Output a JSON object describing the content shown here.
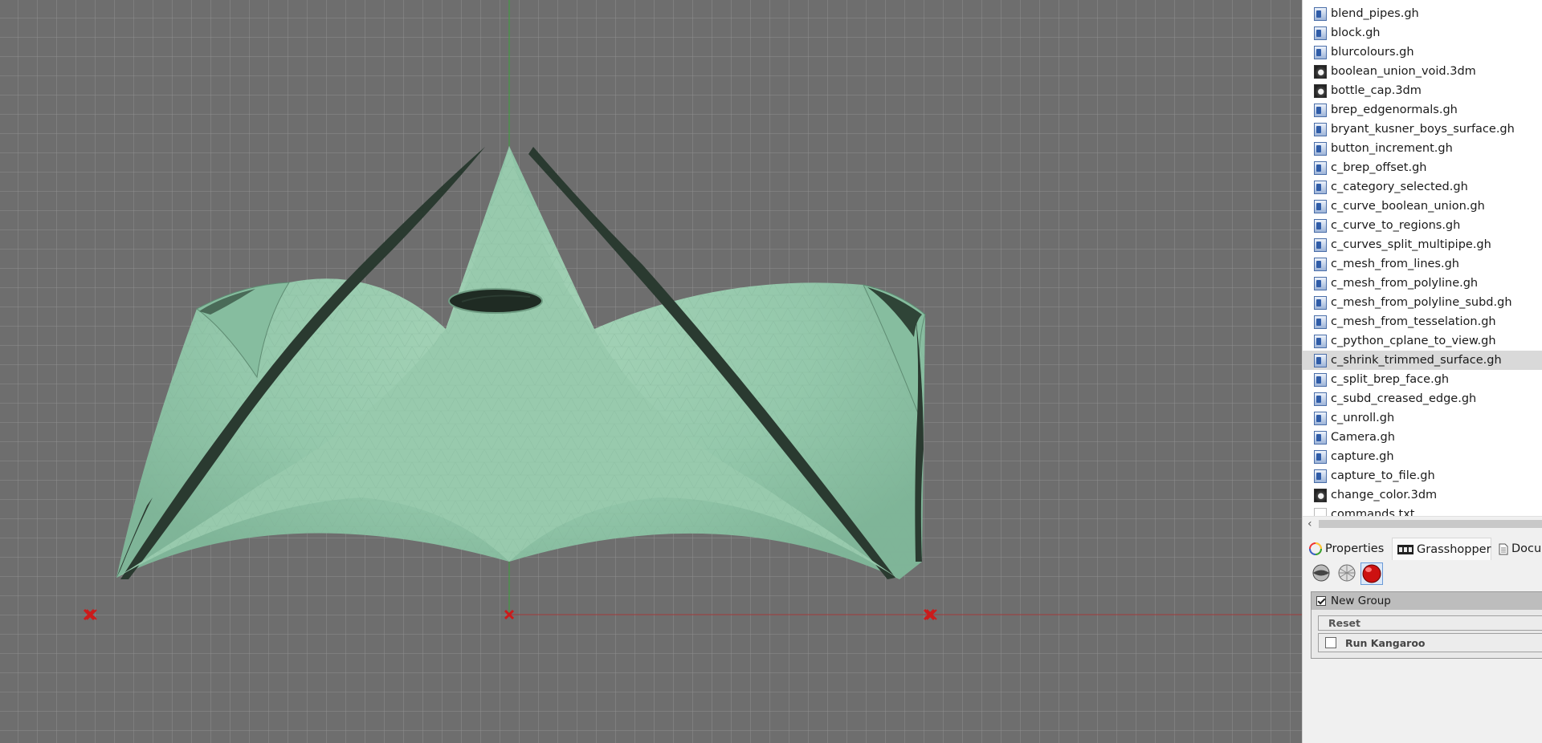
{
  "viewport": {
    "background": "#6e6e6e",
    "grid_color": "#8f8f8f",
    "surface_color": "#8fc3a5",
    "surface_dark": "#2a3a30",
    "x_axis_color": "#a23a3a",
    "y_axis_color": "#3aa23a",
    "anchor_color": "#cc1b1b"
  },
  "file_browser": {
    "files": [
      {
        "name": "blend_pipes.gh",
        "type": "gh"
      },
      {
        "name": "block.gh",
        "type": "gh"
      },
      {
        "name": "blurcolours.gh",
        "type": "gh"
      },
      {
        "name": "boolean_union_void.3dm",
        "type": "3dm"
      },
      {
        "name": "bottle_cap.3dm",
        "type": "3dm"
      },
      {
        "name": "brep_edgenormals.gh",
        "type": "gh"
      },
      {
        "name": "bryant_kusner_boys_surface.gh",
        "type": "gh"
      },
      {
        "name": "button_increment.gh",
        "type": "gh"
      },
      {
        "name": "c_brep_offset.gh",
        "type": "gh"
      },
      {
        "name": "c_category_selected.gh",
        "type": "gh"
      },
      {
        "name": "c_curve_boolean_union.gh",
        "type": "gh"
      },
      {
        "name": "c_curve_to_regions.gh",
        "type": "gh"
      },
      {
        "name": "c_curves_split_multipipe.gh",
        "type": "gh"
      },
      {
        "name": "c_mesh_from_lines.gh",
        "type": "gh"
      },
      {
        "name": "c_mesh_from_polyline.gh",
        "type": "gh"
      },
      {
        "name": "c_mesh_from_polyline_subd.gh",
        "type": "gh"
      },
      {
        "name": "c_mesh_from_tesselation.gh",
        "type": "gh"
      },
      {
        "name": "c_python_cplane_to_view.gh",
        "type": "gh"
      },
      {
        "name": "c_shrink_trimmed_surface.gh",
        "type": "gh",
        "selected": true
      },
      {
        "name": "c_split_brep_face.gh",
        "type": "gh"
      },
      {
        "name": "c_subd_creased_edge.gh",
        "type": "gh"
      },
      {
        "name": "c_unroll.gh",
        "type": "gh"
      },
      {
        "name": "Camera.gh",
        "type": "gh"
      },
      {
        "name": "capture.gh",
        "type": "gh"
      },
      {
        "name": "capture_to_file.gh",
        "type": "gh"
      },
      {
        "name": "change_color.3dm",
        "type": "3dm"
      },
      {
        "name": "commands.txt",
        "type": "txt"
      }
    ],
    "scroll_arrow": "‹"
  },
  "tabs": [
    {
      "label": "Properties",
      "icon": "color-wheel-icon"
    },
    {
      "label": "Grasshopper",
      "icon": "grasshopper-icon",
      "active": true
    },
    {
      "label": "Docum",
      "icon": "document-icon"
    }
  ],
  "group": {
    "title": "New Group",
    "reset_label": "Reset",
    "run_label": "Run Kangaroo"
  }
}
